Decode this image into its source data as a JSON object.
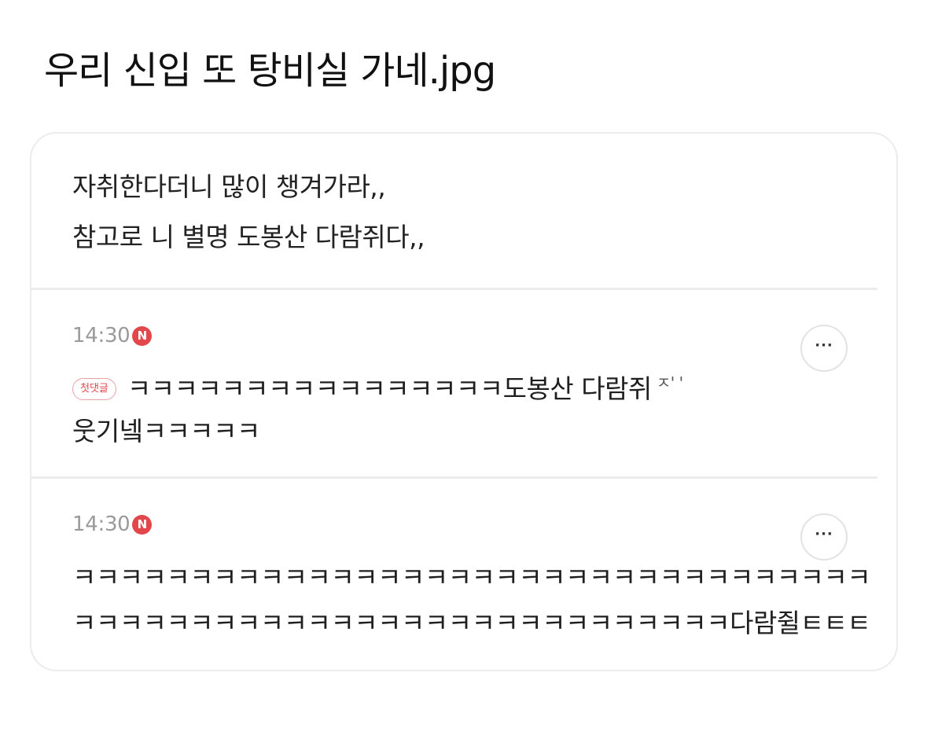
{
  "post": {
    "title": "우리 신입 또 탕비실 가네.jpg"
  },
  "original_post": {
    "line1": "자취한다더니 많이 챙겨가라,,",
    "line2": "참고로 니 별명 도봉산 다람쥐다,,"
  },
  "comments": [
    {
      "time": "14:30",
      "new_badge": "N",
      "first_comment_badge": "첫댓글",
      "line1": "ㅋㅋㅋㅋㅋㅋㅋㅋㅋㅋㅋㅋㅋㅋㅋㅋ도봉산 다람쥐",
      "line1_trailing": "ㅈ' '",
      "line2": "웃기넼ㅋㅋㅋㅋㅋ",
      "more_label": "···"
    },
    {
      "time": "14:30",
      "new_badge": "N",
      "line1": "ㅋㅋㅋㅋㅋㅋㅋㅋㅋㅋㅋㅋㅋㅋㅋㅋㅋㅋㅋㅋㅋㅋㅋㅋㅋㅋㅋㅋㅋㅋㅋㅋㅋㅋ",
      "line2": "ㅋㅋㅋㅋㅋㅋㅋㅋㅋㅋㅋㅋㅋㅋㅋㅋㅋㅋㅋㅋㅋㅋㅋㅋㅋㅋㅋㅋ다람쥘ㅌㅌㅌ",
      "more_label": "···"
    }
  ],
  "colors": {
    "new_badge": "#e2474c",
    "time_text": "#9a9a9a",
    "divider": "#ececec"
  },
  "icons": {
    "more": "more-horizontal-icon",
    "new": "new-badge-icon"
  }
}
